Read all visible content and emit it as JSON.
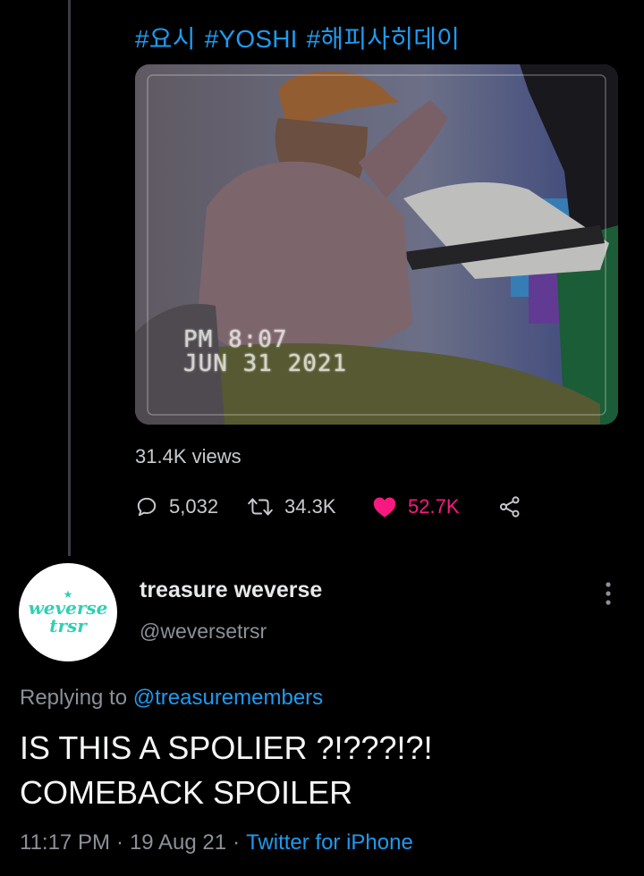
{
  "hashtags": [
    "#요시",
    "#YOSHI",
    "#해피사히데이"
  ],
  "video": {
    "timestamp_line1": "PM  8:07",
    "timestamp_line2": "JUN 31 2021"
  },
  "views_text": "31.4K views",
  "actions": {
    "replies": "5,032",
    "retweets": "34.3K",
    "likes": "52.7K",
    "like_color": "#f91880"
  },
  "reply": {
    "avatar_text_line1": "weverse",
    "avatar_text_line2": "trsr",
    "author_name": "treasure weverse",
    "author_handle": "@weversetrsr",
    "replying_prefix": "Replying to",
    "replying_mention": "@treasuremembers",
    "text_line1": "IS THIS A SPOLIER ?!???!?!",
    "text_line2": "COMEBACK SPOILER",
    "time": "11:17 PM",
    "date": "19 Aug 21",
    "separator": "·",
    "source": "Twitter for iPhone"
  },
  "colors": {
    "accent": "#1d9bf0",
    "background": "#000000",
    "muted": "#8b9197"
  }
}
